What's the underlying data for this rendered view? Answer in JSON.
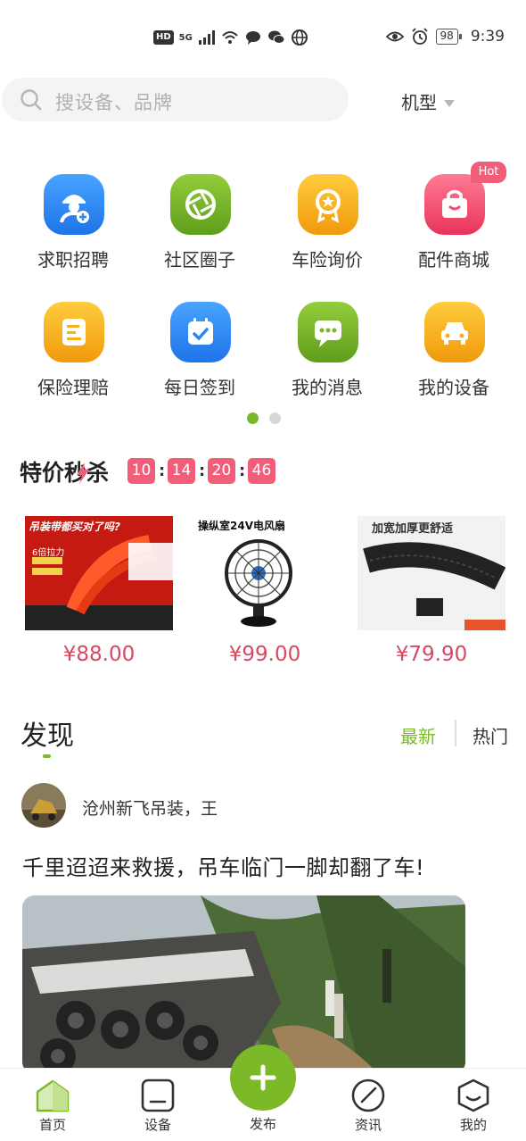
{
  "status_bar": {
    "network": "HD",
    "signal": "5G",
    "battery": "98",
    "time": "9:39"
  },
  "search": {
    "placeholder": "搜设备、品牌",
    "model_label": "机型"
  },
  "quick_menu": {
    "hot_badge": "Hot",
    "items": [
      {
        "label": "求职招聘",
        "icon": "job-recruit-icon",
        "color": "#2f86f0"
      },
      {
        "label": "社区圈子",
        "icon": "community-icon",
        "color": "#78b62a"
      },
      {
        "label": "车险询价",
        "icon": "insurance-quote-icon",
        "color": "#f5b11a"
      },
      {
        "label": "配件商城",
        "icon": "parts-mall-icon",
        "color": "#f04f6e"
      },
      {
        "label": "保险理赔",
        "icon": "insurance-claim-icon",
        "color": "#f5b11a"
      },
      {
        "label": "每日签到",
        "icon": "daily-checkin-icon",
        "color": "#2f86f0"
      },
      {
        "label": "我的消息",
        "icon": "messages-icon",
        "color": "#78b62a"
      },
      {
        "label": "我的设备",
        "icon": "my-device-icon",
        "color": "#f5b11a"
      }
    ],
    "page_count": 2,
    "current_page": 1
  },
  "flash_sale": {
    "title": "特价秒杀",
    "countdown": [
      "10",
      "14",
      "20",
      "46"
    ],
    "products": [
      {
        "price": "¥88.00",
        "image_text": "吊装带都买对了吗?",
        "badge": "6倍拉力"
      },
      {
        "price": "¥99.00",
        "image_text": "操纵室24V电风扇"
      },
      {
        "price": "¥79.90",
        "image_text": "加宽加厚更舒适"
      }
    ]
  },
  "discover": {
    "title": "发现",
    "tabs": {
      "latest": "最新",
      "hot": "热门"
    },
    "post": {
      "author": "沧州新飞吊装，王",
      "title": "千里迢迢来救援，吊车临门一脚却翻了车!"
    }
  },
  "bottom_nav": {
    "home": "首页",
    "device": "设备",
    "publish": "发布",
    "news": "资讯",
    "mine": "我的"
  },
  "colors": {
    "accent": "#7bb928",
    "price": "#d94861",
    "timer": "#f25d7a"
  }
}
